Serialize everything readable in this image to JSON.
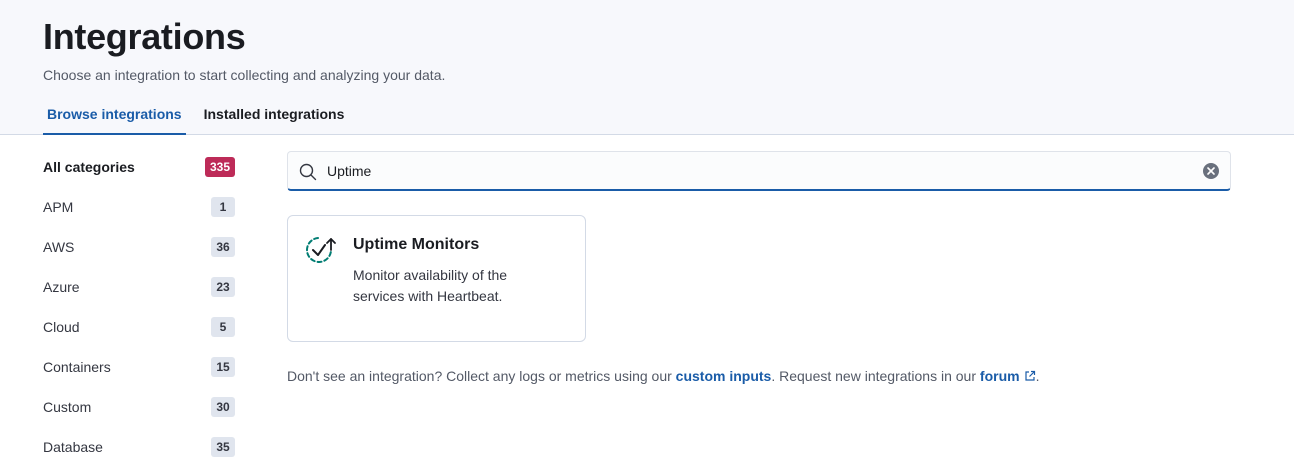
{
  "header": {
    "title": "Integrations",
    "description": "Choose an integration to start collecting and analyzing your data.",
    "tabs": [
      {
        "label": "Browse integrations",
        "active": true
      },
      {
        "label": "Installed integrations",
        "active": false
      }
    ]
  },
  "sidebar": {
    "categories": [
      {
        "label": "All categories",
        "count": "335"
      },
      {
        "label": "APM",
        "count": "1"
      },
      {
        "label": "AWS",
        "count": "36"
      },
      {
        "label": "Azure",
        "count": "23"
      },
      {
        "label": "Cloud",
        "count": "5"
      },
      {
        "label": "Containers",
        "count": "15"
      },
      {
        "label": "Custom",
        "count": "30"
      },
      {
        "label": "Database",
        "count": "35"
      }
    ]
  },
  "search": {
    "value": "Uptime",
    "icon": "search-icon",
    "clear_icon": "clear-icon"
  },
  "results": [
    {
      "title": "Uptime Monitors",
      "description": "Monitor availability of the services with Heartbeat.",
      "icon": "uptime-icon"
    }
  ],
  "footer": {
    "text1": "Don't see an integration? Collect any logs or metrics using our ",
    "link1": "custom inputs",
    "text2": ". Request new integrations in our ",
    "link2": "forum",
    "text3": "."
  },
  "colors": {
    "accent": "#1a5ca8",
    "badge_accent": "#bd2b58",
    "header_bg": "#f7f8fc"
  }
}
